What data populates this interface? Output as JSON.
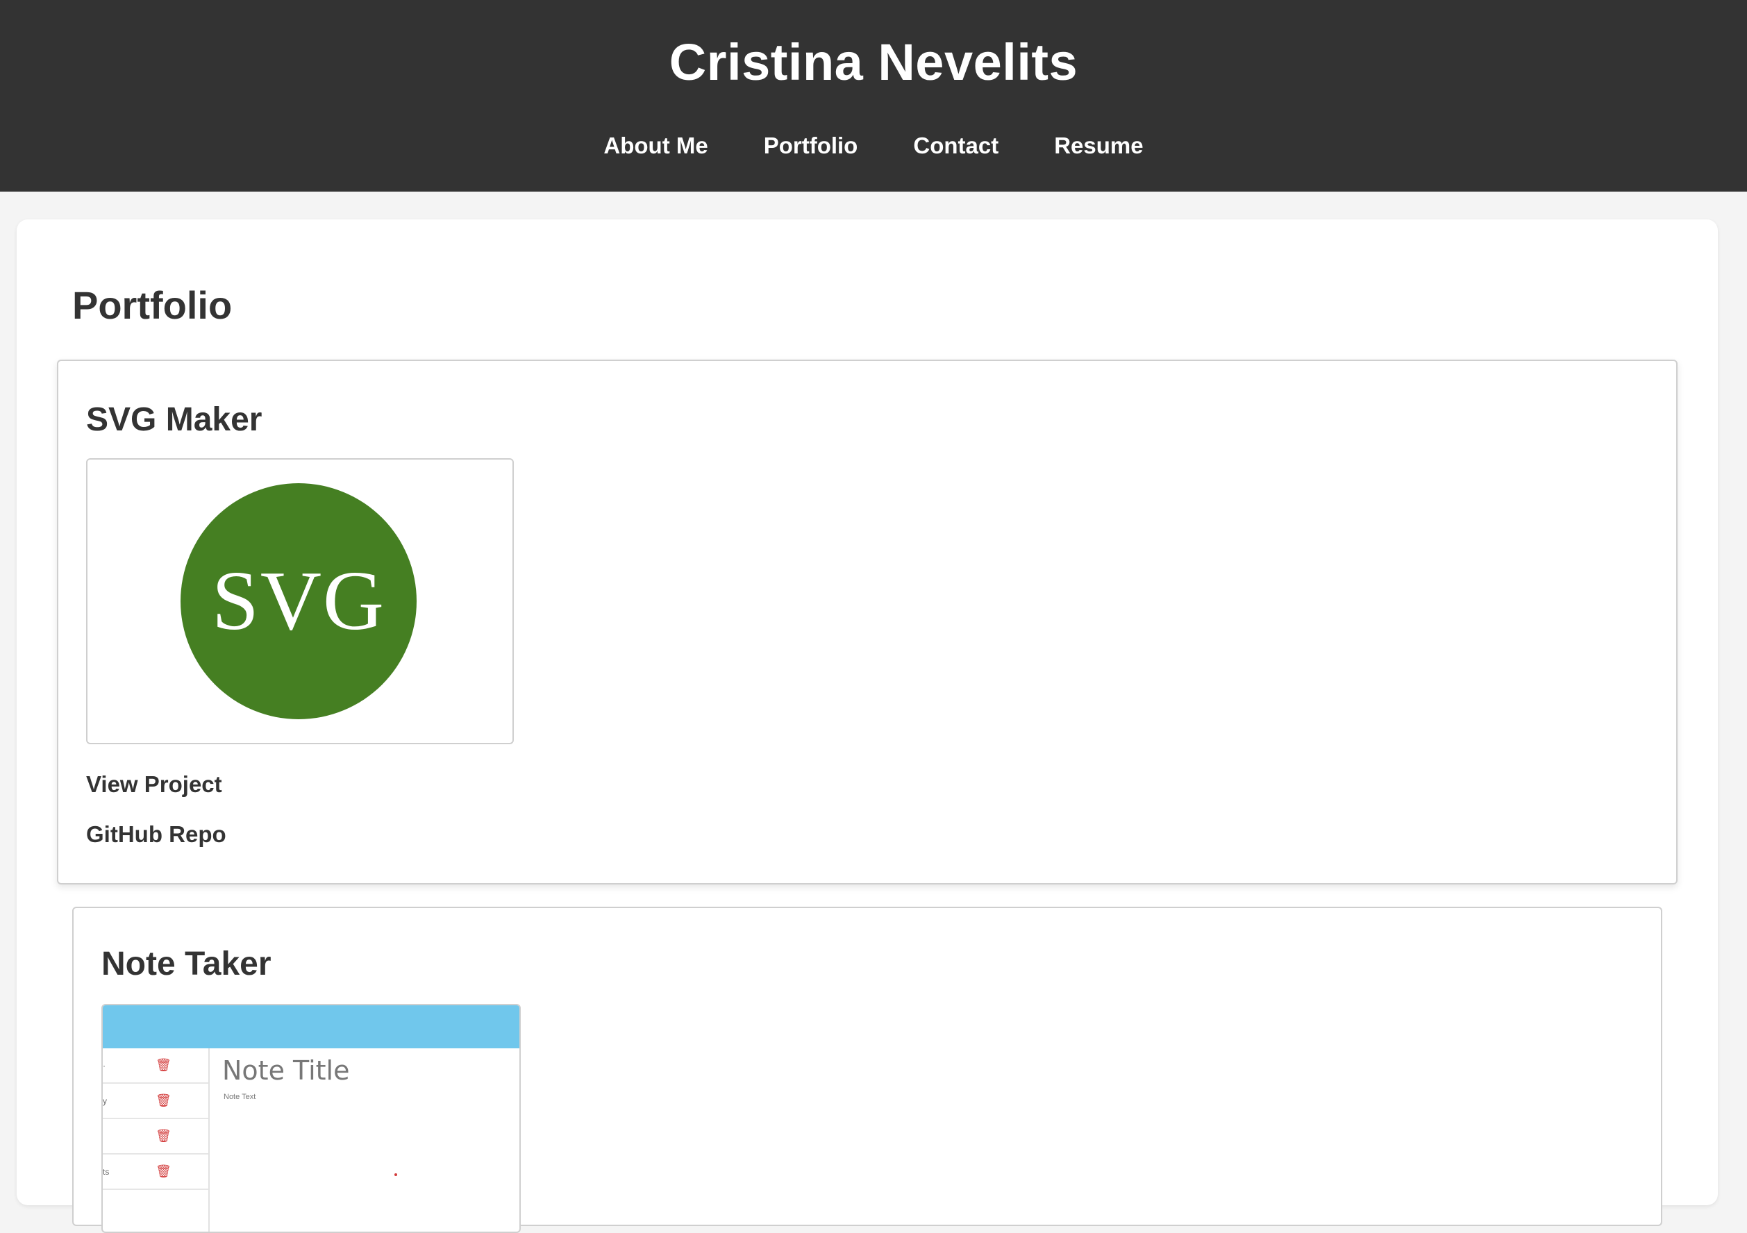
{
  "header": {
    "title": "Cristina Nevelits",
    "nav": [
      "About Me",
      "Portfolio",
      "Contact",
      "Resume"
    ]
  },
  "main": {
    "section_title": "Portfolio",
    "projects": [
      {
        "title": "SVG Maker",
        "logo_text": "SVG",
        "logo_color": "#457f22",
        "view_label": "View Project",
        "repo_label": "GitHub Repo"
      },
      {
        "title": "Note Taker",
        "preview": {
          "bar_color": "#70c7ec",
          "list_fragments": [
            "·",
            "y",
            "",
            "ts"
          ],
          "note_title": "Note Title",
          "note_text": "Note Text"
        }
      }
    ]
  },
  "colors": {
    "header_bg": "#333333",
    "page_bg": "#f4f4f4"
  }
}
